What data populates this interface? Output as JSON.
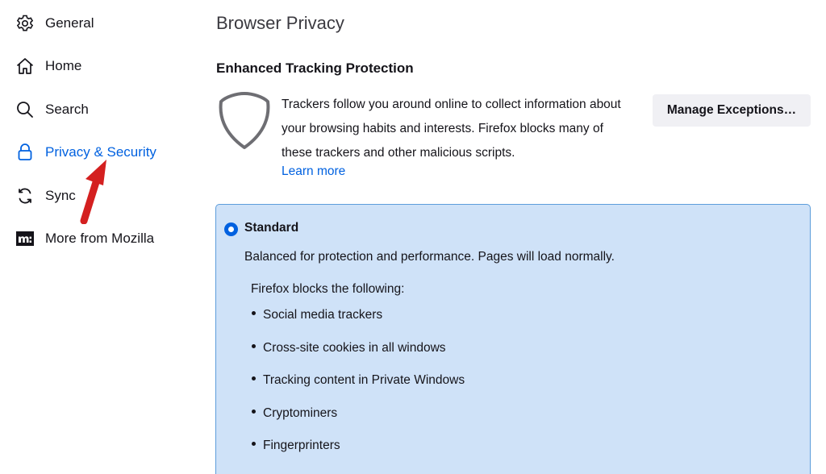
{
  "sidebar": {
    "items": [
      {
        "label": "General",
        "icon": "gear-icon"
      },
      {
        "label": "Home",
        "icon": "home-icon"
      },
      {
        "label": "Search",
        "icon": "search-icon"
      },
      {
        "label": "Privacy & Security",
        "icon": "lock-icon",
        "active": true
      },
      {
        "label": "Sync",
        "icon": "sync-icon"
      },
      {
        "label": "More from Mozilla",
        "icon": "mozilla-logo-icon"
      }
    ]
  },
  "main": {
    "page_title": "Browser Privacy",
    "section_title": "Enhanced Tracking Protection",
    "description": "Trackers follow you around online to collect information about your browsing habits and interests. Firefox blocks many of these trackers and other malicious scripts.",
    "learn_more": "Learn more",
    "manage_exceptions_label": "Manage Exceptions…",
    "standard": {
      "label": "Standard",
      "description": "Balanced for protection and performance. Pages will load normally.",
      "blocks_title": "Firefox blocks the following:",
      "items": [
        "Social media trackers",
        "Cross-site cookies in all windows",
        "Tracking content in Private Windows",
        "Cryptominers",
        "Fingerprinters"
      ]
    }
  },
  "colors": {
    "accent": "#0061e0",
    "panel_bg": "#cfe2f8",
    "panel_border": "#5d9ddb",
    "annotation_arrow": "#d42020"
  }
}
